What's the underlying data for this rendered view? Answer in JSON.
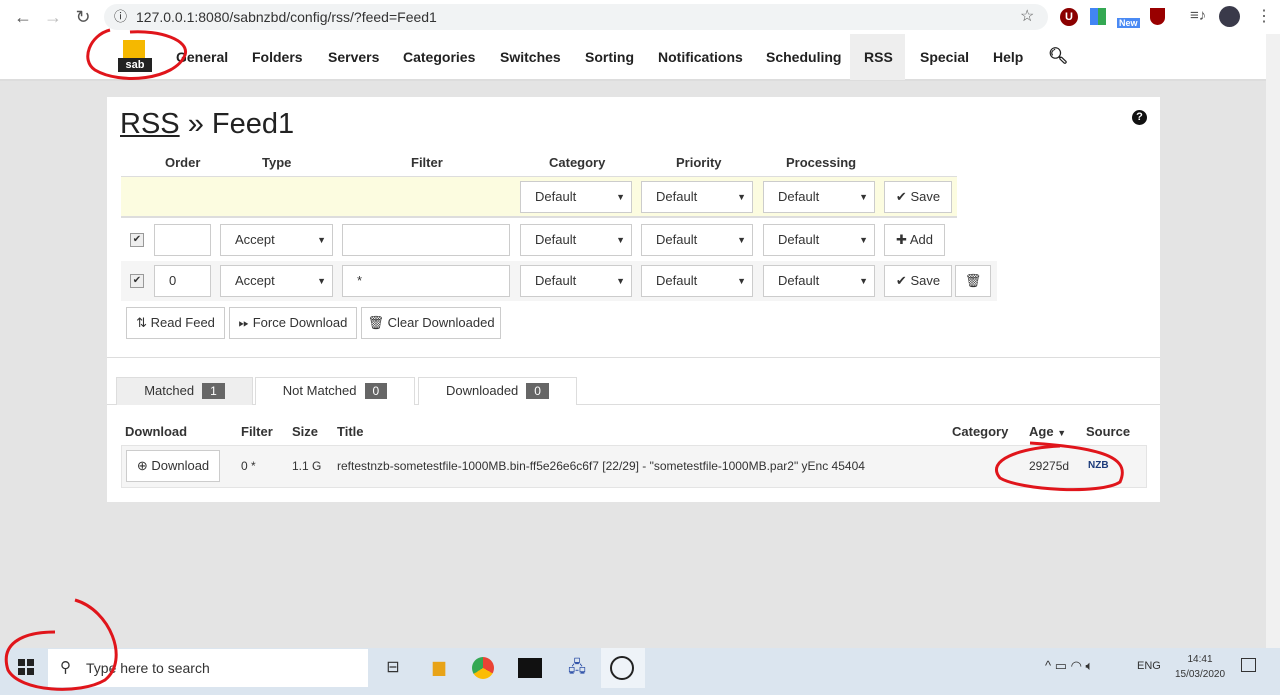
{
  "browser": {
    "url": "127.0.0.1:8080/sabnzbd/config/rss/?feed=Feed1",
    "ext_new_badge": "New"
  },
  "nav": {
    "logo_text": "sab",
    "items": [
      "General",
      "Folders",
      "Servers",
      "Categories",
      "Switches",
      "Sorting",
      "Notifications",
      "Scheduling",
      "RSS",
      "Special",
      "Help"
    ],
    "active": "RSS"
  },
  "page": {
    "title_link": "RSS",
    "title_sep": "»",
    "title_feed": "Feed1"
  },
  "filters": {
    "headers": {
      "order": "Order",
      "type": "Type",
      "filter": "Filter",
      "category": "Category",
      "priority": "Priority",
      "processing": "Processing"
    },
    "feed_row": {
      "category": "Default",
      "priority": "Default",
      "processing": "Default",
      "save": "Save"
    },
    "new_row": {
      "checked": true,
      "order": "",
      "type": "Accept",
      "filter": "",
      "category": "Default",
      "priority": "Default",
      "processing": "Default",
      "add": "Add"
    },
    "rows": [
      {
        "checked": true,
        "order": "0",
        "type": "Accept",
        "filter": "*",
        "category": "Default",
        "priority": "Default",
        "processing": "Default",
        "save": "Save"
      }
    ]
  },
  "actions": {
    "read_feed": "Read Feed",
    "force_download": "Force Download",
    "clear_downloaded": "Clear Downloaded"
  },
  "tabs": [
    {
      "label": "Matched",
      "count": "1"
    },
    {
      "label": "Not Matched",
      "count": "0"
    },
    {
      "label": "Downloaded",
      "count": "0"
    }
  ],
  "results": {
    "headers": {
      "download": "Download",
      "filter": "Filter",
      "size": "Size",
      "title": "Title",
      "category": "Category",
      "age": "Age",
      "source": "Source"
    },
    "rows": [
      {
        "download": "Download",
        "filter": "0 *",
        "size": "1.1 G",
        "title": "reftestnzb-sometestfile-1000MB.bin-ff5e26e6c6f7 [22/29] - \"sometestfile-1000MB.par2\" yEnc 45404",
        "category": "",
        "age": "29275d",
        "source": "NZB"
      }
    ]
  },
  "taskbar": {
    "search_placeholder": "Type here to search",
    "lang": "ENG",
    "time": "14:41",
    "date": "15/03/2020"
  },
  "colors": {
    "annotation": "#e0151b",
    "feed_row_bg": "#fcfce0",
    "badge": "#666666"
  }
}
